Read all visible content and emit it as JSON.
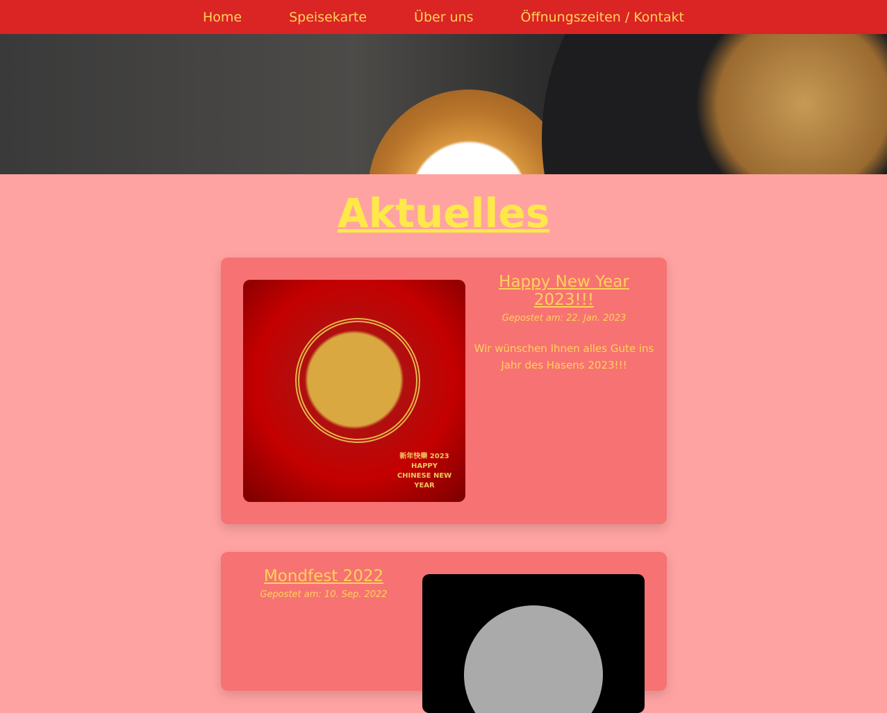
{
  "nav": {
    "items": [
      "Home",
      "Speisekarte",
      "Über uns",
      "Öffnungszeiten / Kontakt"
    ]
  },
  "page": {
    "title": "Aktuelles"
  },
  "posts": [
    {
      "title": "Happy New Year 2023!!!",
      "date": "Gepostet am: 22. Jan. 2023",
      "text": "Wir wünschen Ihnen alles Gute ins Jahr des Hasens 2023!!!",
      "image_text": "新年快樂 2023 HAPPY CHINESE NEW YEAR"
    },
    {
      "title": "Mondfest 2022",
      "date": "Gepostet am: 10. Sep. 2022"
    }
  ],
  "colors": {
    "nav": "#db2424",
    "background": "#ffa3a2",
    "card": "#f77272",
    "text": "#ffd35a",
    "heading": "#ffe84a"
  }
}
